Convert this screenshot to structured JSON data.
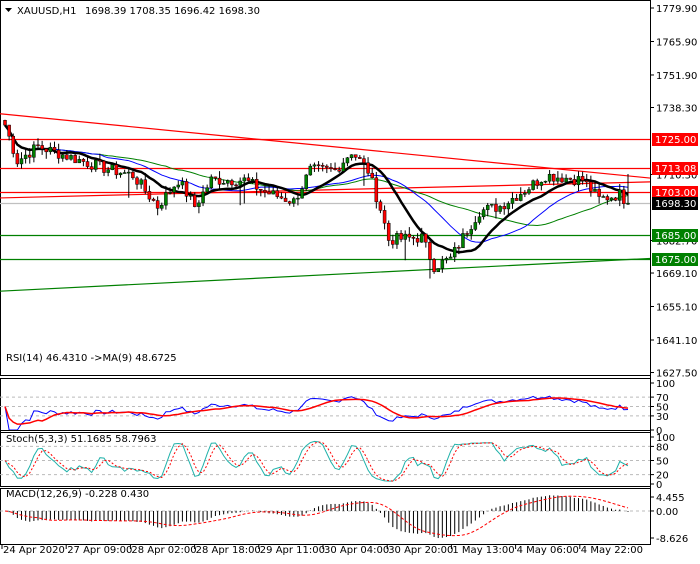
{
  "header": {
    "symbol": "XAUUSD,H1",
    "ohlc": "1698.39 1708.35 1696.42 1698.30"
  },
  "colors": {
    "bull": "#008000",
    "bear": "#ff0000",
    "resistance": "#ff0000",
    "support": "#008000",
    "ma_fast": "#000000",
    "ma_mid": "#0000ff",
    "ma_slow": "#008000",
    "current": "#000000"
  },
  "price_axis": {
    "ticks": [
      "1779.90",
      "1765.90",
      "1751.90",
      "1738.30",
      "1710.30",
      "1682.70",
      "1669.10",
      "1655.10",
      "1641.10",
      "1627.50"
    ],
    "tick_values": [
      1779.9,
      1765.9,
      1751.9,
      1738.3,
      1710.3,
      1682.7,
      1669.1,
      1655.1,
      1641.1,
      1627.5
    ],
    "range": [
      1627.5,
      1779.9
    ]
  },
  "levels": [
    {
      "label": "1725.00",
      "value": 1725.0,
      "type": "resistance"
    },
    {
      "label": "1713.08",
      "value": 1713.08,
      "type": "resistance"
    },
    {
      "label": "1703.00",
      "value": 1703.0,
      "type": "resistance"
    },
    {
      "label": "1698.30",
      "value": 1698.3,
      "type": "current"
    },
    {
      "label": "1685.00",
      "value": 1685.0,
      "type": "support"
    },
    {
      "label": "1675.00",
      "value": 1675.0,
      "type": "support"
    }
  ],
  "trendlines": [
    {
      "name": "descending-resistance",
      "from": 1735.7,
      "to": 1708.8,
      "type": "resistance"
    },
    {
      "name": "ascending-resistance",
      "from": 1700.5,
      "to": 1707.2,
      "type": "resistance"
    },
    {
      "name": "ascending-support",
      "from": 1661.5,
      "to": 1675.2,
      "type": "support"
    }
  ],
  "price_path": [
    [
      0,
      1731
    ],
    [
      3,
      1716
    ],
    [
      8,
      1722
    ],
    [
      15,
      1718
    ],
    [
      24,
      1713
    ],
    [
      31,
      1710
    ],
    [
      37,
      1697
    ],
    [
      42,
      1708
    ],
    [
      46,
      1697
    ],
    [
      50,
      1708
    ],
    [
      58,
      1708
    ],
    [
      63,
      1703
    ],
    [
      70,
      1699
    ],
    [
      74,
      1712
    ],
    [
      80,
      1712
    ],
    [
      84,
      1720
    ],
    [
      88,
      1712
    ],
    [
      91,
      1696
    ],
    [
      93,
      1683
    ],
    [
      101,
      1684
    ],
    [
      104,
      1672
    ],
    [
      108,
      1675
    ],
    [
      112,
      1687
    ],
    [
      115,
      1695
    ],
    [
      120,
      1697
    ],
    [
      127,
      1705
    ],
    [
      131,
      1710
    ],
    [
      140,
      1708
    ],
    [
      144,
      1700
    ],
    [
      149,
      1702
    ],
    [
      151,
      1698.3
    ]
  ],
  "candle_count": 152,
  "time_axis": [
    "24 Apr 2020",
    "27 Apr 09:00",
    "28 Apr 02:00",
    "28 Apr 18:00",
    "29 Apr 11:00",
    "30 Apr 04:00",
    "30 Apr 20:00",
    "1 May 13:00",
    "4 May 06:00",
    "4 May 22:00"
  ],
  "rsi": {
    "title": "RSI(14) 46.4310  ->MA(9) 48.6725",
    "ticks": [
      "100",
      "70",
      "50",
      "30",
      "0"
    ],
    "tick_values": [
      100,
      70,
      50,
      30,
      0
    ]
  },
  "stoch": {
    "title": "Stoch(5,3,3) 51.1685 58.7963",
    "ticks": [
      "100",
      "80",
      "50",
      "20",
      "0"
    ],
    "tick_values": [
      100,
      80,
      50,
      20,
      0
    ]
  },
  "macd": {
    "title": "MACD(12,26,9) -0.228 0.430",
    "ticks": [
      "4.455",
      "0.00",
      "-8.626"
    ],
    "tick_values": [
      4.455,
      0,
      -8.626
    ]
  }
}
